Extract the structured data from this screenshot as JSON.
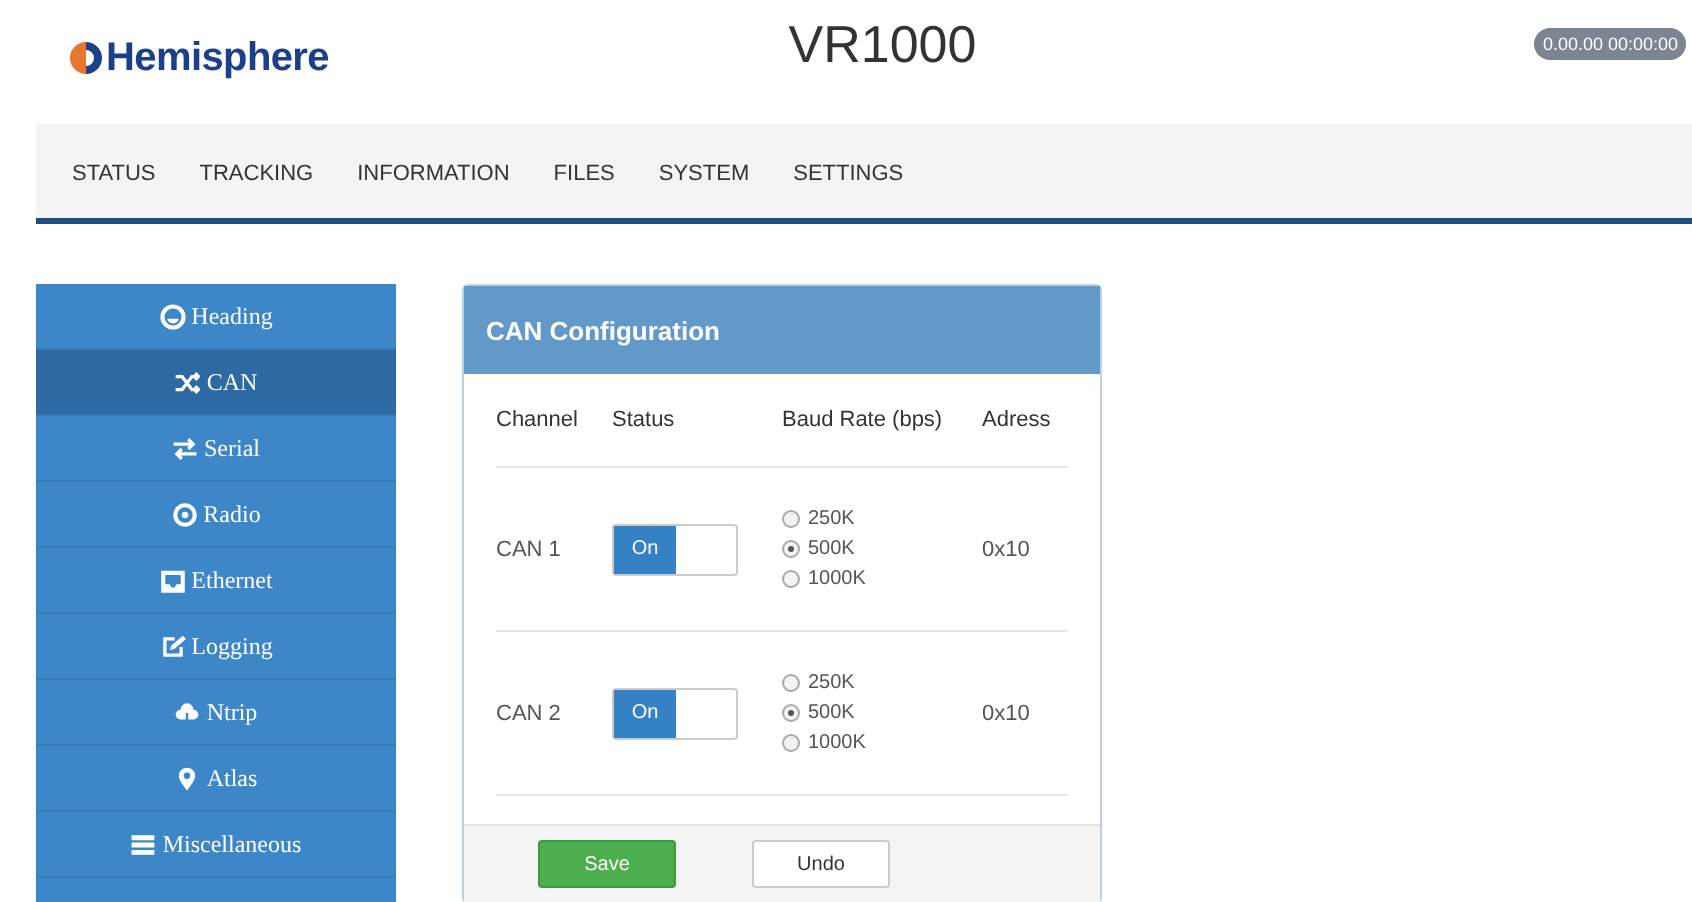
{
  "header": {
    "logo": "Hemisphere",
    "title": "VR1000",
    "clock": "0.00.00 00:00:00"
  },
  "nav": [
    {
      "label": "STATUS"
    },
    {
      "label": "TRACKING"
    },
    {
      "label": "INFORMATION"
    },
    {
      "label": "FILES"
    },
    {
      "label": "SYSTEM"
    },
    {
      "label": "SETTINGS"
    }
  ],
  "sidebar": {
    "items": [
      {
        "label": "Heading",
        "selected": false
      },
      {
        "label": "CAN",
        "selected": true
      },
      {
        "label": "Serial",
        "selected": false
      },
      {
        "label": "Radio",
        "selected": false
      },
      {
        "label": "Ethernet",
        "selected": false
      },
      {
        "label": "Logging",
        "selected": false
      },
      {
        "label": "Ntrip",
        "selected": false
      },
      {
        "label": "Atlas",
        "selected": false
      },
      {
        "label": "Miscellaneous",
        "selected": false
      }
    ]
  },
  "panel": {
    "title": "CAN Configuration",
    "columns": [
      "Channel",
      "Status",
      "Baud Rate (bps)",
      "Adress"
    ],
    "rows": [
      {
        "channel": "CAN 1",
        "toggle": {
          "label": "On",
          "on": true
        },
        "rates": [
          {
            "label": "250K",
            "selected": false
          },
          {
            "label": "500K",
            "selected": true
          },
          {
            "label": "1000K",
            "selected": false
          }
        ],
        "address": "0x10"
      },
      {
        "channel": "CAN 2",
        "toggle": {
          "label": "On",
          "on": true
        },
        "rates": [
          {
            "label": "250K",
            "selected": false
          },
          {
            "label": "500K",
            "selected": true
          },
          {
            "label": "1000K",
            "selected": false
          }
        ],
        "address": "0x10"
      }
    ],
    "buttons": [
      {
        "label": "Save",
        "kind": "primary"
      },
      {
        "label": "Undo",
        "kind": "default"
      }
    ]
  }
}
